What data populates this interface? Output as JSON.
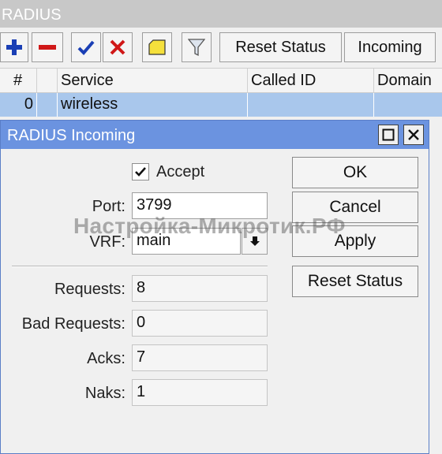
{
  "window": {
    "title": "RADIUS"
  },
  "toolbar": {
    "reset_status_label": "Reset Status",
    "incoming_label": "Incoming",
    "add_icon": "plus-icon",
    "remove_icon": "minus-icon",
    "enable_icon": "check-icon",
    "disable_icon": "x-icon",
    "comment_icon": "note-icon",
    "filter_icon": "filter-icon"
  },
  "table": {
    "headers": [
      "#",
      "",
      "Service",
      "Called ID",
      "Domain"
    ],
    "rows": [
      {
        "num": "0",
        "service": "wireless",
        "called_id": "",
        "domain": ""
      }
    ]
  },
  "dialog": {
    "title": "RADIUS Incoming",
    "accept_label": "Accept",
    "accept_checked": true,
    "port_label": "Port:",
    "port_value": "3799",
    "vrf_label": "VRF:",
    "vrf_value": "main",
    "requests_label": "Requests:",
    "requests_value": "8",
    "bad_requests_label": "Bad Requests:",
    "bad_requests_value": "0",
    "acks_label": "Acks:",
    "acks_value": "7",
    "naks_label": "Naks:",
    "naks_value": "1",
    "ok_label": "OK",
    "cancel_label": "Cancel",
    "apply_label": "Apply",
    "reset_status_label": "Reset Status"
  },
  "watermark": {
    "text": "Настройка-Микротик.РФ"
  },
  "colors": {
    "dialog_title_bg": "#6b93e0",
    "selected_row": "#a9c7ec",
    "main_title_bg": "#c8c8c8"
  }
}
